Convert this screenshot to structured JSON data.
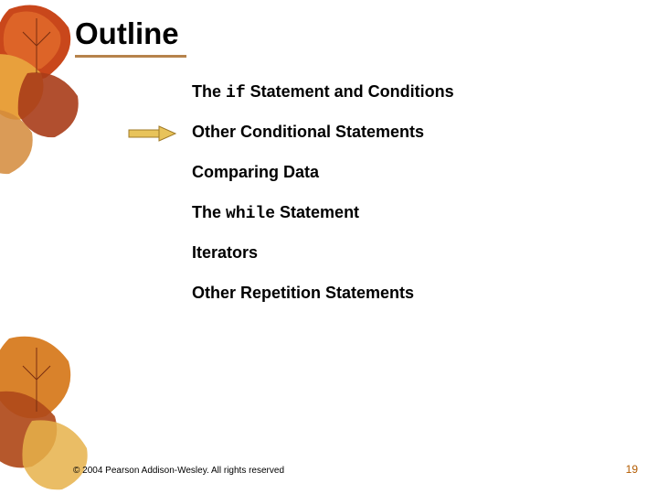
{
  "title": "Outline",
  "items": [
    {
      "prefix": "The ",
      "code": "if",
      "suffix": " Statement and Conditions"
    },
    {
      "prefix": "Other Conditional Statements",
      "code": "",
      "suffix": ""
    },
    {
      "prefix": "Comparing Data",
      "code": "",
      "suffix": ""
    },
    {
      "prefix": "The ",
      "code": "while",
      "suffix": " Statement"
    },
    {
      "prefix": "Iterators",
      "code": "",
      "suffix": ""
    },
    {
      "prefix": "Other Repetition Statements",
      "code": "",
      "suffix": ""
    }
  ],
  "current_index": 1,
  "footer": {
    "copyright": "© 2004 Pearson Addison-Wesley. All rights reserved",
    "page": "19"
  }
}
